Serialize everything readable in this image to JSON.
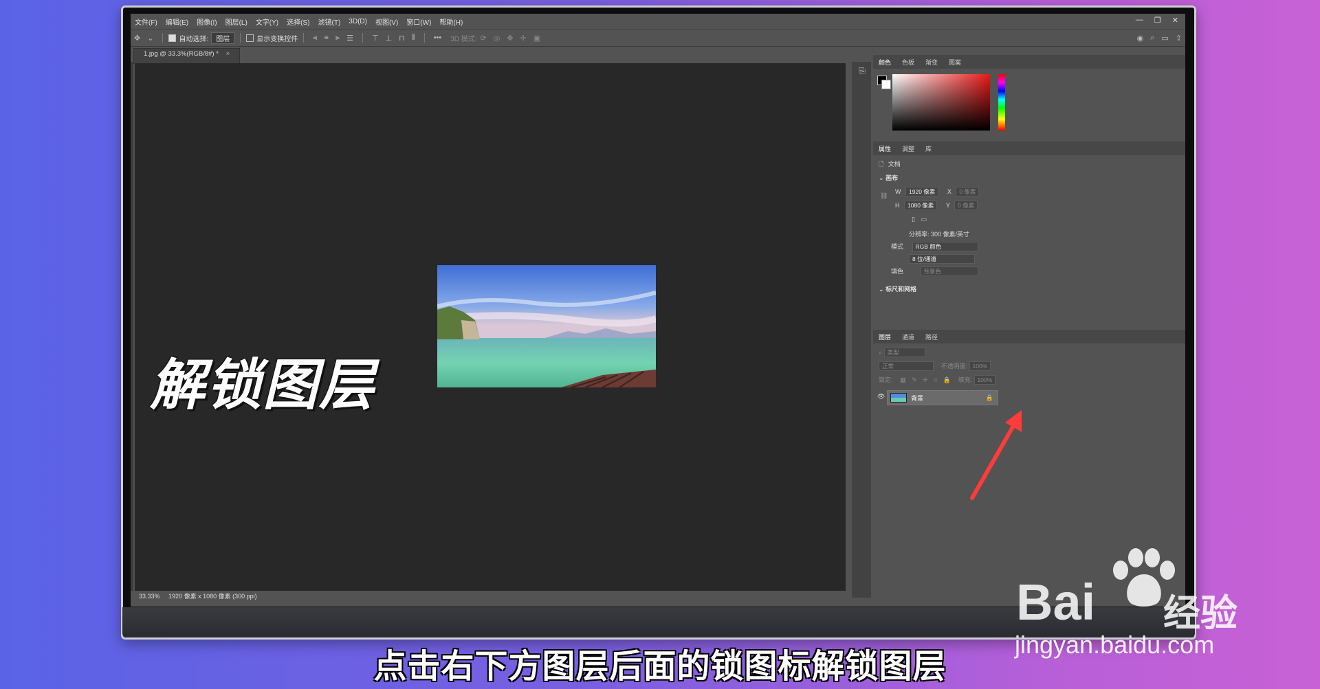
{
  "menu": [
    "文件(F)",
    "编辑(E)",
    "图像(I)",
    "图层(L)",
    "文字(Y)",
    "选择(S)",
    "滤镜(T)",
    "3D(D)",
    "视图(V)",
    "窗口(W)",
    "帮助(H)"
  ],
  "window_controls": [
    "—",
    "❐",
    "✕"
  ],
  "options": {
    "auto_select_label": "自动选择:",
    "auto_select_value": "图层",
    "show_transform_label": "显示变换控件",
    "mode_3d_label": "3D 模式:"
  },
  "document_tab": "1.jpg @ 33.3%(RGB/8#) *",
  "status": {
    "zoom": "33.33%",
    "info": "1920 像素 x 1080 像素 (300 ppi)"
  },
  "overlay_title": "解锁图层",
  "panels": {
    "color_tabs": [
      "颜色",
      "色板",
      "渐变",
      "图案"
    ],
    "prop_tabs": [
      "属性",
      "调整",
      "库"
    ],
    "doc_label": "文档",
    "canvas_section": "画布",
    "w_label": "W",
    "w_value": "1920 像素",
    "x_label": "X",
    "x_value": "0 像素",
    "h_label": "H",
    "h_value": "1080 像素",
    "y_label": "Y",
    "y_value": "0 像素",
    "resolution": "分辨率: 300 像素/英寸",
    "mode_label": "模式",
    "mode_value": "RGB 颜色",
    "depth_value": "8 位/通道",
    "fill_label": "填色",
    "fill_value": "背景色",
    "rulers_section": "标尺和网格",
    "layer_tabs": [
      "图层",
      "通道",
      "路径"
    ],
    "kind_placeholder": "类型",
    "blend_mode": "正常",
    "opacity_label": "不透明度:",
    "opacity_value": "100%",
    "lock_label": "锁定:",
    "fill2_label": "填充:",
    "fill2_value": "100%",
    "layer_name": "背景"
  },
  "subtitle": "点击右下方图层后面的锁图标解锁图层",
  "watermark": {
    "brand": "Bai",
    "cn": "经验",
    "url": "jingyan.baidu.com"
  }
}
